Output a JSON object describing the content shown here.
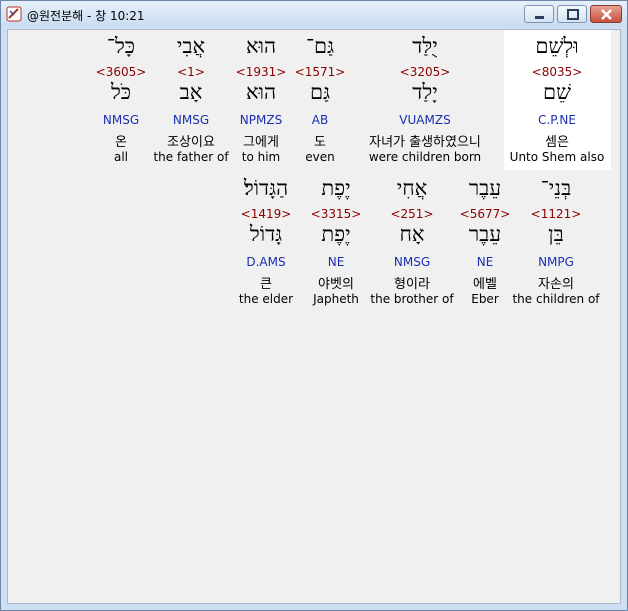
{
  "window": {
    "title": "@원전분해 - 창 10:21"
  },
  "row1": [
    {
      "heb1": "וּלְשֵׁם",
      "strong": "<8035>",
      "heb2": "שֵׁם",
      "parse": "C.P.NE",
      "kor": "셈은",
      "eng": "Unto Shem also"
    },
    {
      "heb1": "יֻלַּד",
      "strong": "<3205>",
      "heb2": "יָלַד",
      "parse": "VUAMZS",
      "kor": "자녀가 출생하였으니",
      "eng": "were children born"
    },
    {
      "heb1": "גַּם־",
      "strong": "<1571>",
      "heb2": "גַּם",
      "parse": "AB",
      "kor": "도",
      "eng": "even"
    },
    {
      "heb1": "הוּא",
      "strong": "<1931>",
      "heb2": "הוּא",
      "parse": "NPMZS",
      "kor": "그에게",
      "eng": "to him"
    },
    {
      "heb1": "אֲבִי",
      "strong": "<1>",
      "heb2": "אָב",
      "parse": "NMSG",
      "kor": "조상이요",
      "eng": "the father of"
    },
    {
      "heb1": "כָּל־",
      "strong": "<3605>",
      "heb2": "כֹּל",
      "parse": "NMSG",
      "kor": "온",
      "eng": "all"
    }
  ],
  "row2": [
    {
      "heb1": "בְּנֵי־",
      "strong": "<1121>",
      "heb2": "בֵּן",
      "parse": "NMPG",
      "kor": "자손의",
      "eng": "the children of"
    },
    {
      "heb1": "עֵבֶר",
      "strong": "<5677>",
      "heb2": "עֵבֶר",
      "parse": "NE",
      "kor": "에벨",
      "eng": "Eber"
    },
    {
      "heb1": "אֲחִי",
      "strong": "<251>",
      "heb2": "אָח",
      "parse": "NMSG",
      "kor": "형이라",
      "eng": "the brother of"
    },
    {
      "heb1": "יֶפֶת",
      "strong": "<3315>",
      "heb2": "יֶפֶת",
      "parse": "NE",
      "kor": "야벳의",
      "eng": "Japheth"
    },
    {
      "heb1": "הַגָּדוֹל׃",
      "strong": "<1419>",
      "heb2": "גָּדוֹל",
      "parse": "D.AMS",
      "kor": "큰",
      "eng": "the elder"
    }
  ]
}
